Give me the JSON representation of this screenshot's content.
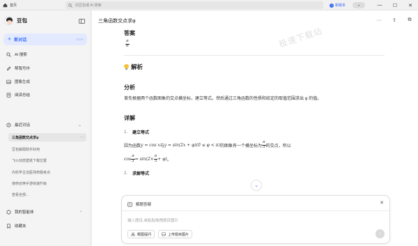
{
  "titlebar": {
    "home_label": "首页",
    "search_placeholder": "向豆包或 AI 搜索",
    "new_version": "新版本",
    "close_glyph": "✕",
    "maximize_glyph": "☐",
    "minimize_glyph": "—"
  },
  "sidebar": {
    "brand": "豆包",
    "new_chat": "新对话",
    "new_chat_shortcut": "Ctrl K",
    "nav": [
      {
        "label": "AI 搜索",
        "icon": "search-icon"
      },
      {
        "label": "帮我写作",
        "icon": "pen-icon"
      },
      {
        "label": "图像生成",
        "icon": "image-icon"
      },
      {
        "label": "阅读总结",
        "icon": "book-icon"
      }
    ],
    "recent_label": "最近对话",
    "history": [
      "三角函数交点求φ",
      "豆包解题助手好用",
      "飞火动态壁纸下载位置",
      "内科学主治医师命题考点",
      "使命召唤手游快速升级",
      "查看全部..."
    ],
    "agents_label": "我的智能体",
    "favorites_label": "收藏夹"
  },
  "main": {
    "chat_title": "三角函数交点求φ",
    "watermark": "极速下载站",
    "answer_heading": "答案",
    "answer_num": "π",
    "answer_den": "6",
    "analysis_heading": "解析",
    "section_analysis": "分析",
    "analysis_text": "首先根据两个函数图象的交点横坐标，建立等式。然后通过三角函数的性质和给定的取值范围求出 φ 的值。",
    "section_detail": "详解",
    "step1_num": "1.",
    "step1_title": "建立等式",
    "line1_a": "因为函数",
    "line1_m1": "y = cos x",
    "line1_b": "与",
    "line1_m2": "y = sin(2x + φ)(0 ≤ φ < π)",
    "line1_c": "的图象有一个横坐标为",
    "line1_fnum": "π",
    "line1_fden": "3",
    "line1_d": "的交点，所以",
    "line2_m1": "cos",
    "line2_fnum": "π",
    "line2_fden": "3",
    "line2_m2": "= sin(2×",
    "line2_fnum2": "π",
    "line2_fden2": "3",
    "line2_m3": "+ φ)",
    "line2_end": "。",
    "step2_num": "2.",
    "step2_title": "求解等式"
  },
  "input": {
    "mode_label": "解题答疑",
    "placeholder": "输入题目,或粘贴拖拽题目图片",
    "btn_screenshot": "截图提问",
    "btn_upload": "上传题目图片",
    "close_glyph": "✕",
    "send_glyph": "↑"
  },
  "colors": {
    "accent": "#3b6cf6",
    "sidebar_bg": "#f4f4f4",
    "main_bg": "#ffffff"
  }
}
